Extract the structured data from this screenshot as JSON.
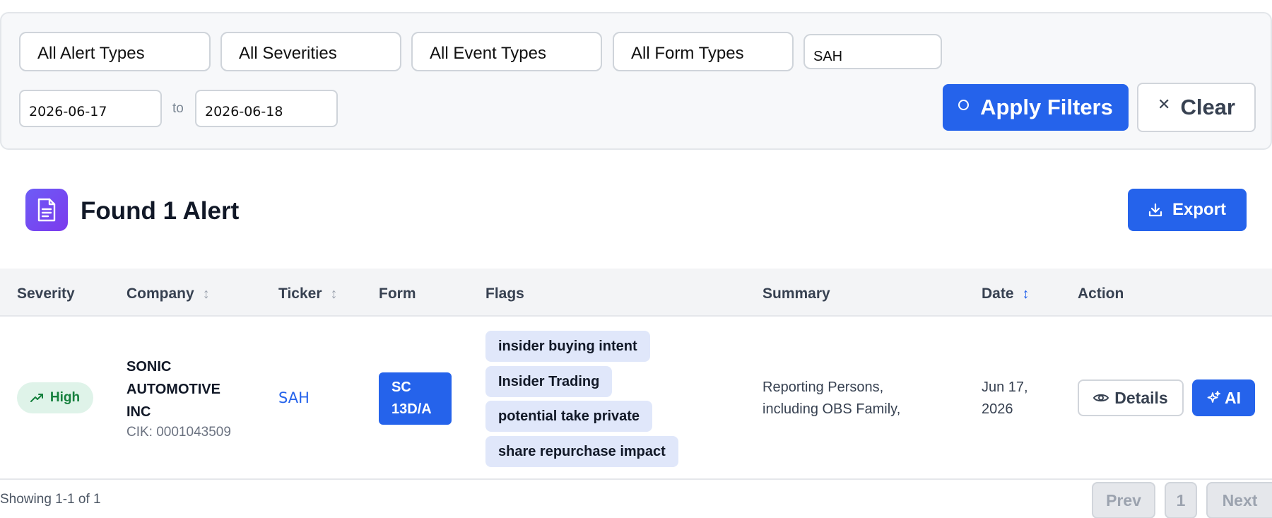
{
  "filters": {
    "alert_type": "All Alert Types",
    "severity": "All Severities",
    "event_type": "All Event Types",
    "form_type": "All Form Types",
    "ticker_value": "SAH",
    "date_from": "2026-06-17",
    "date_to_label": "to",
    "date_to": "2026-06-18",
    "apply_label": "Apply Filters",
    "clear_label": "Clear"
  },
  "results": {
    "title": "Found 1 Alert",
    "export_label": "Export"
  },
  "table": {
    "columns": [
      "Severity",
      "Company",
      "Ticker",
      "Form",
      "Flags",
      "Summary",
      "Date",
      "Action"
    ],
    "rows": [
      {
        "severity": "High",
        "company": "SONIC AUTOMOTIVE INC",
        "cik": "CIK: 0001043509",
        "ticker": "SAH",
        "form": "SC 13D/A",
        "flags": [
          "insider buying intent",
          "Insider Trading",
          "potential take private",
          "share repurchase impact"
        ],
        "summary": "Reporting Persons, including OBS Family,",
        "date": "Jun 17, 2026",
        "details_label": "Details",
        "ai_label": "AI"
      }
    ]
  },
  "pagination": {
    "showing": "Showing 1-1 of 1",
    "prev_label": "Prev",
    "current_page": "1",
    "next_label": "Next"
  },
  "colors": {
    "primary": "#2563eb",
    "severity_high_bg": "#dff3e9",
    "severity_high_text": "#15803d",
    "flag_bg": "#e0e7fa",
    "doc_badge": "#7c3aed"
  },
  "icons": {
    "apply": "circle-icon",
    "clear": "close-icon",
    "results": "document-icon",
    "export": "download-icon",
    "sort": "sort-icon",
    "severity": "trending-up-icon",
    "details": "eye-icon",
    "ai": "sparkles-icon"
  }
}
